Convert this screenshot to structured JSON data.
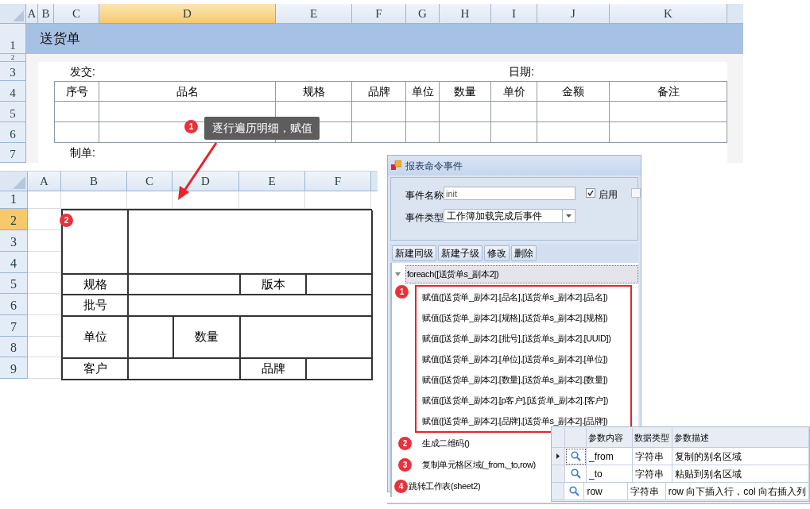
{
  "sheet1": {
    "columns": [
      {
        "label": "A",
        "selected": false
      },
      {
        "label": "B",
        "selected": false
      },
      {
        "label": "C",
        "selected": false
      },
      {
        "label": "D",
        "selected": true
      },
      {
        "label": "E",
        "selected": false
      },
      {
        "label": "F",
        "selected": false
      },
      {
        "label": "G",
        "selected": false
      },
      {
        "label": "H",
        "selected": false
      },
      {
        "label": "I",
        "selected": false
      },
      {
        "label": "J",
        "selected": false
      },
      {
        "label": "K",
        "selected": false
      }
    ],
    "row_headers": [
      "1",
      "2",
      "3",
      "4",
      "5",
      "6",
      "7"
    ],
    "title": "送货单",
    "from_label": "发交:",
    "date_label": "日期:",
    "table_header": [
      "序号",
      "品名",
      "规格",
      "品牌",
      "单位",
      "数量",
      "单价",
      "金额",
      "备注"
    ],
    "maker_label": "制单:"
  },
  "callout": {
    "badge": "1",
    "text": "逐行遍历明细，赋值"
  },
  "sheet2": {
    "columns": [
      {
        "label": "A",
        "selected": false
      },
      {
        "label": "B",
        "selected": false
      },
      {
        "label": "C",
        "selected": false
      },
      {
        "label": "D",
        "selected": false
      },
      {
        "label": "E",
        "selected": false
      },
      {
        "label": "F",
        "selected": false
      }
    ],
    "row_headers": [
      {
        "label": "1",
        "selected": false
      },
      {
        "label": "2",
        "selected": true
      },
      {
        "label": "3",
        "selected": false
      },
      {
        "label": "4",
        "selected": false
      },
      {
        "label": "5",
        "selected": false
      },
      {
        "label": "6",
        "selected": false
      },
      {
        "label": "7",
        "selected": false
      },
      {
        "label": "8",
        "selected": false
      },
      {
        "label": "9",
        "selected": false
      }
    ],
    "badge": "2",
    "cells": [
      "规格",
      "版本",
      "批号",
      "单位",
      "数量",
      "客户",
      "品牌"
    ]
  },
  "dialog": {
    "title": "报表命令事件",
    "name_label": "事件名称",
    "name_value": "init",
    "enabled": {
      "label": "启用",
      "checked": true
    },
    "second_checkbox": {
      "checked": false
    },
    "type_label": "事件类型",
    "type_value": "工作簿加载完成后事件",
    "toolbar": [
      "新建同级",
      "新建子级",
      "修改",
      "删除"
    ],
    "tree": [
      {
        "label": "foreach([送货单s_副本2])",
        "selected": true,
        "expanded": true,
        "children": [
          {
            "label": "赋值([送货单_副本2].[品名],[送货单s_副本2].[品名])",
            "selected": false,
            "highlight": true,
            "badge": "1"
          },
          {
            "label": "赋值([送货单_副本2].[规格],[送货单s_副本2].[规格])",
            "selected": false,
            "highlight": true
          },
          {
            "label": "赋值([送货单_副本2].[批号],[送货单s_副本2].[UUID])",
            "selected": false,
            "highlight": true
          },
          {
            "label": "赋值([送货单_副本2].[单位],[送货单s_副本2].[单位])",
            "selected": false,
            "highlight": true
          },
          {
            "label": "赋值([送货单_副本2].[数量],[送货单s_副本2].[数量])",
            "selected": false,
            "highlight": true
          },
          {
            "label": "赋值([送货单_副本2].[p客户],[送货单_副本2].[客户])",
            "selected": false,
            "highlight": true
          },
          {
            "label": "赋值([送货单_副本2].[品牌],[送货单s_副本2].[品牌])",
            "selected": false,
            "highlight": true
          },
          {
            "label": "生成二维码()",
            "selected": false,
            "highlight": false,
            "badge": "2"
          },
          {
            "label": "复制单元格区域(_from,_to,row)",
            "selected": false,
            "highlight": false,
            "badge": "3"
          }
        ]
      },
      {
        "label": "跳转工作表(sheet2)",
        "selected": false,
        "badge": "4"
      }
    ]
  },
  "params": {
    "columns": [
      "参数内容",
      "数据类型",
      "参数描述"
    ],
    "rows": [
      {
        "name": "_from",
        "type": "字符串",
        "description": "复制的别名区域",
        "selected": true
      },
      {
        "name": "_to",
        "type": "字符串",
        "description": "粘贴到别名区域",
        "selected": false
      },
      {
        "name": "row",
        "type": "字符串",
        "description": "row 向下插入行，col 向右插入列",
        "selected": false
      }
    ]
  }
}
